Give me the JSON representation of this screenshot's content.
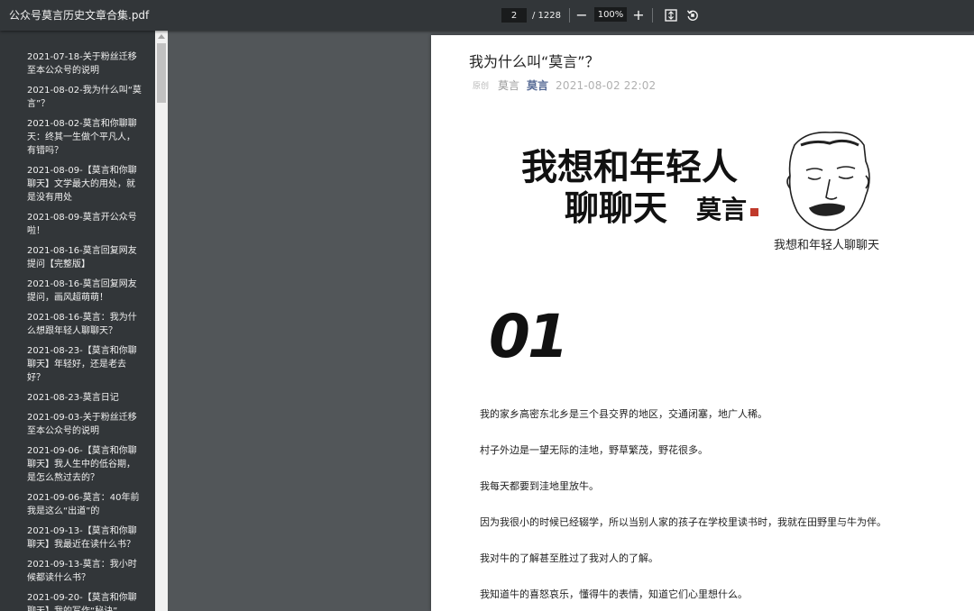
{
  "toolbar": {
    "title": "公众号莫言历史文章合集.pdf",
    "page_current": "2",
    "page_total": "/ 1228",
    "zoom": "100%",
    "zoom_out_label": "−",
    "zoom_in_label": "+"
  },
  "outline": [
    "2021-07-18-关于粉丝迁移至本公众号的说明",
    "2021-08-02-我为什么叫“莫言”？",
    "2021-08-02-莫言和你聊聊天：终其一生做个平凡人，有错吗？",
    "2021-08-09-【莫言和你聊聊天】文学最大的用处，就是没有用处",
    "2021-08-09-莫言开公众号啦！",
    "2021-08-16-莫言回复网友提问【完整版】",
    "2021-08-16-莫言回复网友提问，画风超萌萌！",
    "2021-08-16-莫言：我为什么想跟年轻人聊聊天？",
    "2021-08-23-【莫言和你聊聊天】年轻好，还是老去好？",
    "2021-08-23-莫言日记",
    "2021-09-03-关于粉丝迁移至本公众号的说明",
    "2021-09-06-【莫言和你聊聊天】我人生中的低谷期，是怎么熬过去的？",
    "2021-09-06-莫言：40年前我是这么“出道”的",
    "2021-09-13-【莫言和你聊聊天】我最近在读什么书？",
    "2021-09-13-莫言：我小时候都读什么书？",
    "2021-09-20-【莫言和你聊聊天】我的写作“秘诀”"
  ],
  "article": {
    "title": "我为什么叫“莫言”？",
    "tag": "原创",
    "author_plain": "莫言",
    "author_link": "莫言",
    "date": "2021-08-02 22:02",
    "banner_line1": "我想和年轻人",
    "banner_line2": "聊聊天",
    "banner_signature": "莫言",
    "banner_caption": "我想和年轻人聊聊天",
    "section_number": "01",
    "paragraphs": [
      "我的家乡高密东北乡是三个县交界的地区，交通闭塞，地广人稀。",
      "村子外边是一望无际的洼地，野草繁茂，野花很多。",
      "我每天都要到洼地里放牛。",
      "因为我很小的时候已经辍学，所以当别人家的孩子在学校里读书时，我就在田野里与牛为伴。",
      "我对牛的了解甚至胜过了我对人的了解。",
      "我知道牛的喜怒哀乐，懂得牛的表情，知道它们心里想什么。"
    ]
  },
  "colors": {
    "toolbar_bg": "#323639",
    "viewer_bg": "#525659",
    "author_link": "#576b95"
  }
}
